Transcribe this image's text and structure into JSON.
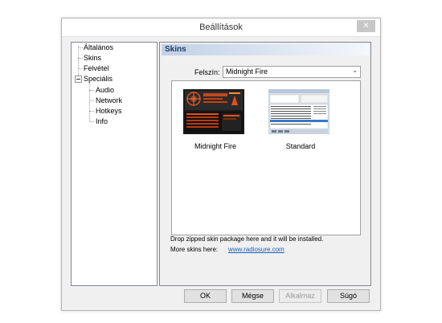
{
  "window": {
    "title": "Beállítások",
    "close_glyph": "✕"
  },
  "tree": {
    "items": [
      {
        "label": "Általános"
      },
      {
        "label": "Skins"
      },
      {
        "label": "Felvétel"
      },
      {
        "label": "Speciális"
      },
      {
        "label": "Audio"
      },
      {
        "label": "Network"
      },
      {
        "label": "Hotkeys"
      },
      {
        "label": "Info"
      }
    ]
  },
  "panel": {
    "header": "Skins",
    "felszin_label": "Felszín:",
    "felszin_value": "Midnight Fire",
    "skins": [
      {
        "label": "Midnight Fire"
      },
      {
        "label": "Standard"
      }
    ],
    "drop_text": "Drop zipped skin package here and it will be installed.",
    "more_label": "More skins here:",
    "more_link": "www.radiosure.com"
  },
  "buttons": {
    "ok": "OK",
    "cancel": "Mégse",
    "apply": "Alkalmaz",
    "help": "Súgó"
  },
  "colors": {
    "accent": "#1e3c64",
    "fire": "#e8501a",
    "link": "#1a5fb4"
  }
}
